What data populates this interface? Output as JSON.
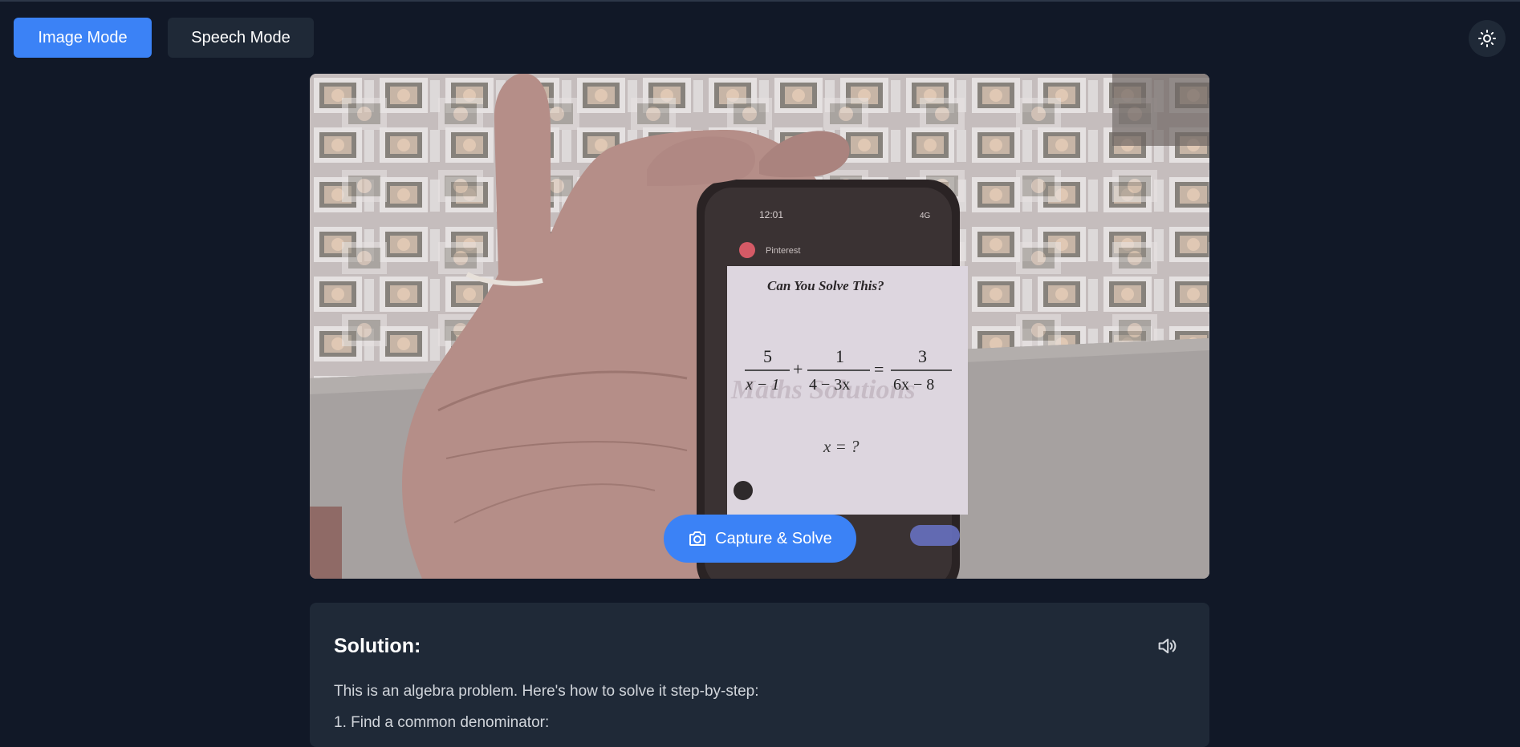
{
  "modes": {
    "image_label": "Image Mode",
    "speech_label": "Speech Mode",
    "active": "image"
  },
  "theme_toggle": {
    "icon": "sun-icon"
  },
  "camera": {
    "phone": {
      "status_time": "12:01",
      "status_signal": "4G",
      "app_name": "Pinterest",
      "puzzle_title": "Can You Solve This?",
      "equation": {
        "t1_num": "5",
        "t1_den": "x − 1",
        "t2_num": "1",
        "t2_den": "4 − 3x",
        "plus": "+",
        "equals": "=",
        "t3_num": "3",
        "t3_den": "6x − 8"
      },
      "question": "x = ?",
      "watermark": "Maths Solutions"
    },
    "capture_label": "Capture & Solve"
  },
  "solution": {
    "heading": "Solution:",
    "intro": "This is an algebra problem. Here's how to solve it step-by-step:",
    "step1": "1. Find a common denominator:"
  },
  "colors": {
    "background": "#111827",
    "panel": "#1f2937",
    "accent": "#3b82f6"
  }
}
